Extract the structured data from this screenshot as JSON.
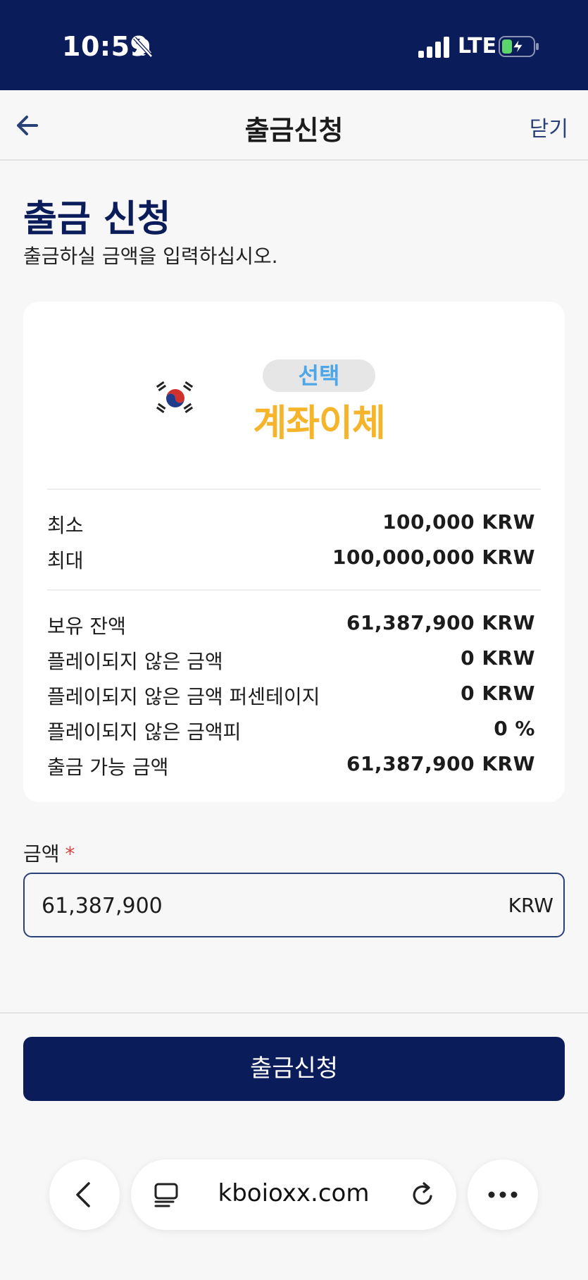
{
  "status_bar": {
    "time": "10:59",
    "network": "LTE",
    "icons": [
      "bell-muted-icon",
      "signal-icon",
      "battery-charging-icon"
    ]
  },
  "navbar": {
    "title": "출금신청",
    "close_label": "닫기",
    "back_icon": "arrow-left-icon"
  },
  "header": {
    "title": "출금 신청",
    "subtitle": "출금하실 금액을 입력하십시오."
  },
  "method": {
    "badge": "선택",
    "name": "계좌이체",
    "flag_icon": "korea-flag-icon"
  },
  "limits": [
    {
      "label": "최소",
      "value": "100,000 KRW"
    },
    {
      "label": "최대",
      "value": "100,000,000 KRW"
    }
  ],
  "balances": [
    {
      "label": "보유 잔액",
      "value": "61,387,900 KRW"
    },
    {
      "label": "플레이되지 않은 금액",
      "value": "0 KRW"
    },
    {
      "label": "플레이되지 않은 금액 퍼센테이지",
      "value": "0 KRW"
    },
    {
      "label": "플레이되지 않은 금액피",
      "value": "0 %"
    },
    {
      "label": "출금 가능 금액",
      "value": "61,387,900 KRW"
    }
  ],
  "amount": {
    "label": "금액",
    "required_mark": "*",
    "value": "61,387,900",
    "unit": "KRW"
  },
  "submit": {
    "label": "출금신청"
  },
  "browser": {
    "url": "kboioxx.com",
    "icons": [
      "chevron-left-icon",
      "tabs-icon",
      "reload-icon",
      "more-icon"
    ]
  },
  "colors": {
    "brand_navy": "#0b1c5a",
    "accent_blue": "#2a4178",
    "logo_orange": "#f6b42a",
    "logo_blue": "#4da6e8",
    "required_red": "#d64545"
  }
}
